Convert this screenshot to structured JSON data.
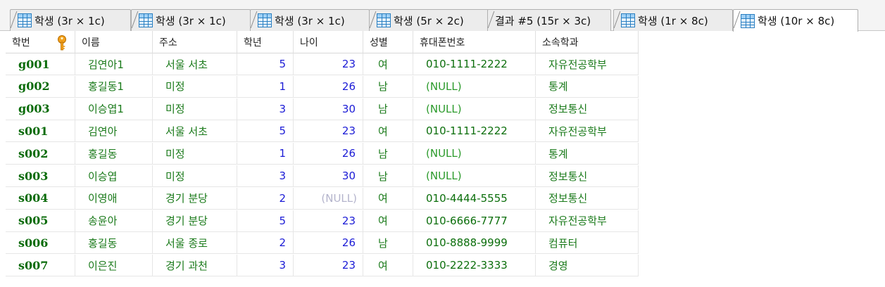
{
  "tabs": [
    {
      "label": "학생 (3r × 1c)",
      "icon": "table-icon",
      "active": false
    },
    {
      "label": "학생 (3r × 1c)",
      "icon": "table-icon",
      "active": false
    },
    {
      "label": "학생 (3r × 1c)",
      "icon": "table-icon",
      "active": false
    },
    {
      "label": "학생 (5r × 2c)",
      "icon": "table-icon",
      "active": false
    },
    {
      "label": "결과 #5 (15r × 3c)",
      "icon": "",
      "active": false
    },
    {
      "label": "학생 (1r × 8c)",
      "icon": "table-icon",
      "active": false
    },
    {
      "label": "학생 (10r × 8c)",
      "icon": "table-icon",
      "active": true
    }
  ],
  "grid": {
    "primary_key_icon": "key-icon",
    "columns": [
      "학번",
      "이름",
      "주소",
      "학년",
      "나이",
      "성별",
      "휴대폰번호",
      "소속학과"
    ],
    "rows": [
      [
        "g001",
        "김연아1",
        "서울 서초",
        "5",
        "23",
        "여",
        "010-1111-2222",
        "자유전공학부"
      ],
      [
        "g002",
        "홍길동1",
        "미정",
        "1",
        "26",
        "남",
        "(NULL)",
        "통계"
      ],
      [
        "g003",
        "이승엽1",
        "미정",
        "3",
        "30",
        "남",
        "(NULL)",
        "정보통신"
      ],
      [
        "s001",
        "김연아",
        "서울 서초",
        "5",
        "23",
        "여",
        "010-1111-2222",
        "자유전공학부"
      ],
      [
        "s002",
        "홍길동",
        "미정",
        "1",
        "26",
        "남",
        "(NULL)",
        "통계"
      ],
      [
        "s003",
        "이승엽",
        "미정",
        "3",
        "30",
        "남",
        "(NULL)",
        "정보통신"
      ],
      [
        "s004",
        "이영애",
        "경기 분당",
        "2",
        "(NULL)",
        "여",
        "010-4444-5555",
        "정보통신"
      ],
      [
        "s005",
        "송윤아",
        "경기 분당",
        "5",
        "23",
        "여",
        "010-6666-7777",
        "자유전공학부"
      ],
      [
        "s006",
        "홍길동",
        "서울 종로",
        "2",
        "26",
        "남",
        "010-8888-9999",
        "컴퓨터"
      ],
      [
        "s007",
        "이은진",
        "경기 과천",
        "3",
        "23",
        "여",
        "010-2222-3333",
        "경영"
      ]
    ]
  },
  "colors": {
    "id_text": "#0a6b0a",
    "number_text": "#1b1bd6",
    "null_text": "#b4b4cc",
    "tab_icon": "#2a7fc1"
  }
}
